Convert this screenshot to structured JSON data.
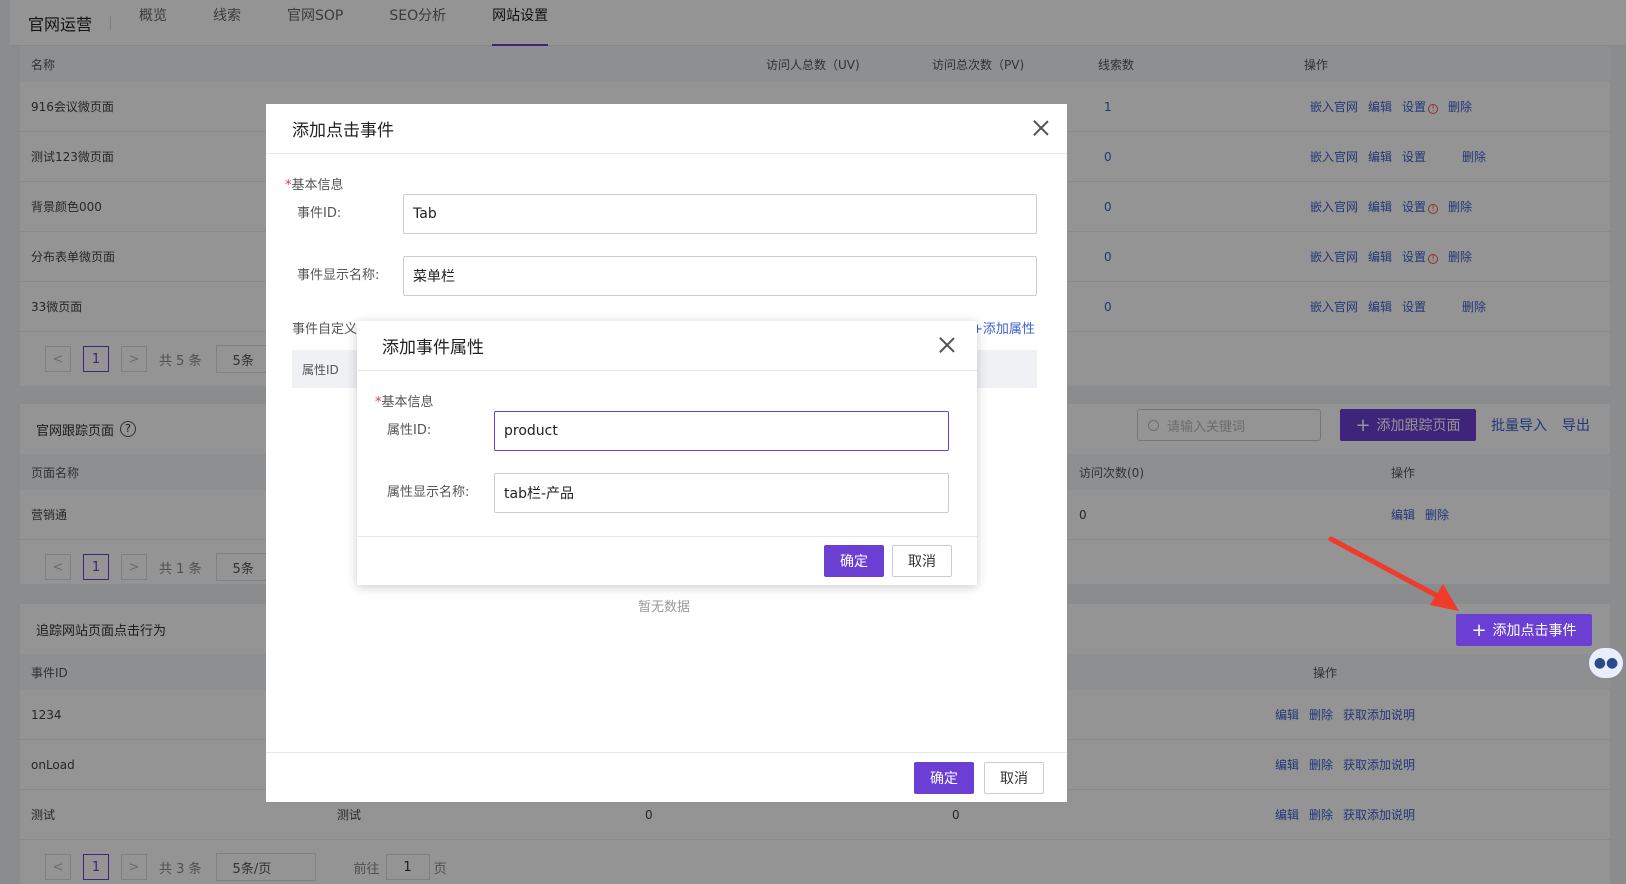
{
  "topnav": {
    "title": "官网运营",
    "tabs": [
      "概览",
      "线索",
      "官网SOP",
      "SEO分析",
      "网站设置"
    ],
    "active_tab": "网站设置"
  },
  "pages_table": {
    "headers": [
      "名称",
      "访问人总数（UV)",
      "访问总次数（PV)",
      "线索数",
      "操作"
    ],
    "rows": [
      {
        "name": "916会议微页面",
        "leads": "1",
        "warn": true
      },
      {
        "name": "测试123微页面",
        "leads": "0",
        "warn": false
      },
      {
        "name": "背景颜色000",
        "leads": "0",
        "warn": true
      },
      {
        "name": "分布表单微页面",
        "leads": "0",
        "warn": true
      },
      {
        "name": "33微页面",
        "leads": "0",
        "warn": false
      }
    ],
    "ops": {
      "embed": "嵌入官网",
      "edit": "编辑",
      "settings": "设置",
      "delete": "删除"
    },
    "pager": {
      "prev": "<",
      "page": "1",
      "next": ">",
      "total": "共 5 条",
      "size": "5条"
    }
  },
  "tracking_section": {
    "title": "官网跟踪页面",
    "help_icon": "?",
    "search_placeholder": "请输入关键词",
    "add_button": "添加跟踪页面",
    "batch_import": "批量导入",
    "export": "导出",
    "headers": [
      "页面名称",
      "访问次数(0)",
      "操作"
    ],
    "rows": [
      {
        "name": "营销通",
        "visits": "0"
      }
    ],
    "ops": {
      "edit": "编辑",
      "delete": "删除"
    },
    "pager": {
      "prev": "<",
      "page": "1",
      "next": ">",
      "total": "共 1 条",
      "size": "5条"
    }
  },
  "click_section": {
    "title": "追踪网站页面点击行为",
    "add_button": "添加点击事件",
    "headers": [
      "事件ID",
      "操作"
    ],
    "rows": [
      {
        "id": "1234",
        "name": "",
        "c3": "",
        "c4": ""
      },
      {
        "id": "onLoad",
        "name": "",
        "c3": "",
        "c4": ""
      },
      {
        "id": "测试",
        "name": "测试",
        "c3": "0",
        "c4": "0"
      }
    ],
    "ops": {
      "edit": "编辑",
      "delete": "删除",
      "get": "获取添加说明"
    },
    "pager": {
      "prev": "<",
      "page": "1",
      "next": ">",
      "total": "共 3 条",
      "size": "5条/页",
      "goto": "前往",
      "goto_page": "1",
      "page_unit": "页"
    }
  },
  "modal_click_event": {
    "title": "添加点击事件",
    "section_label": "基本信息",
    "event_id_label": "事件ID:",
    "event_id_value": "Tab",
    "event_name_label": "事件显示名称:",
    "event_name_value": "菜单栏",
    "custom_label": "事件自定义",
    "add_attr": "+添加属性",
    "attr_header": "属性ID",
    "empty": "暂无数据",
    "ok": "确定",
    "cancel": "取消"
  },
  "modal_attr": {
    "title": "添加事件属性",
    "section_label": "基本信息",
    "attr_id_label": "属性ID:",
    "attr_id_value": "product",
    "attr_name_label": "属性显示名称:",
    "attr_name_value": "tab栏-产品",
    "ok": "确定",
    "cancel": "取消"
  },
  "colors": {
    "primary": "#6b3fd4",
    "link": "#3a5fcf",
    "arrow": "#f03a2a"
  }
}
